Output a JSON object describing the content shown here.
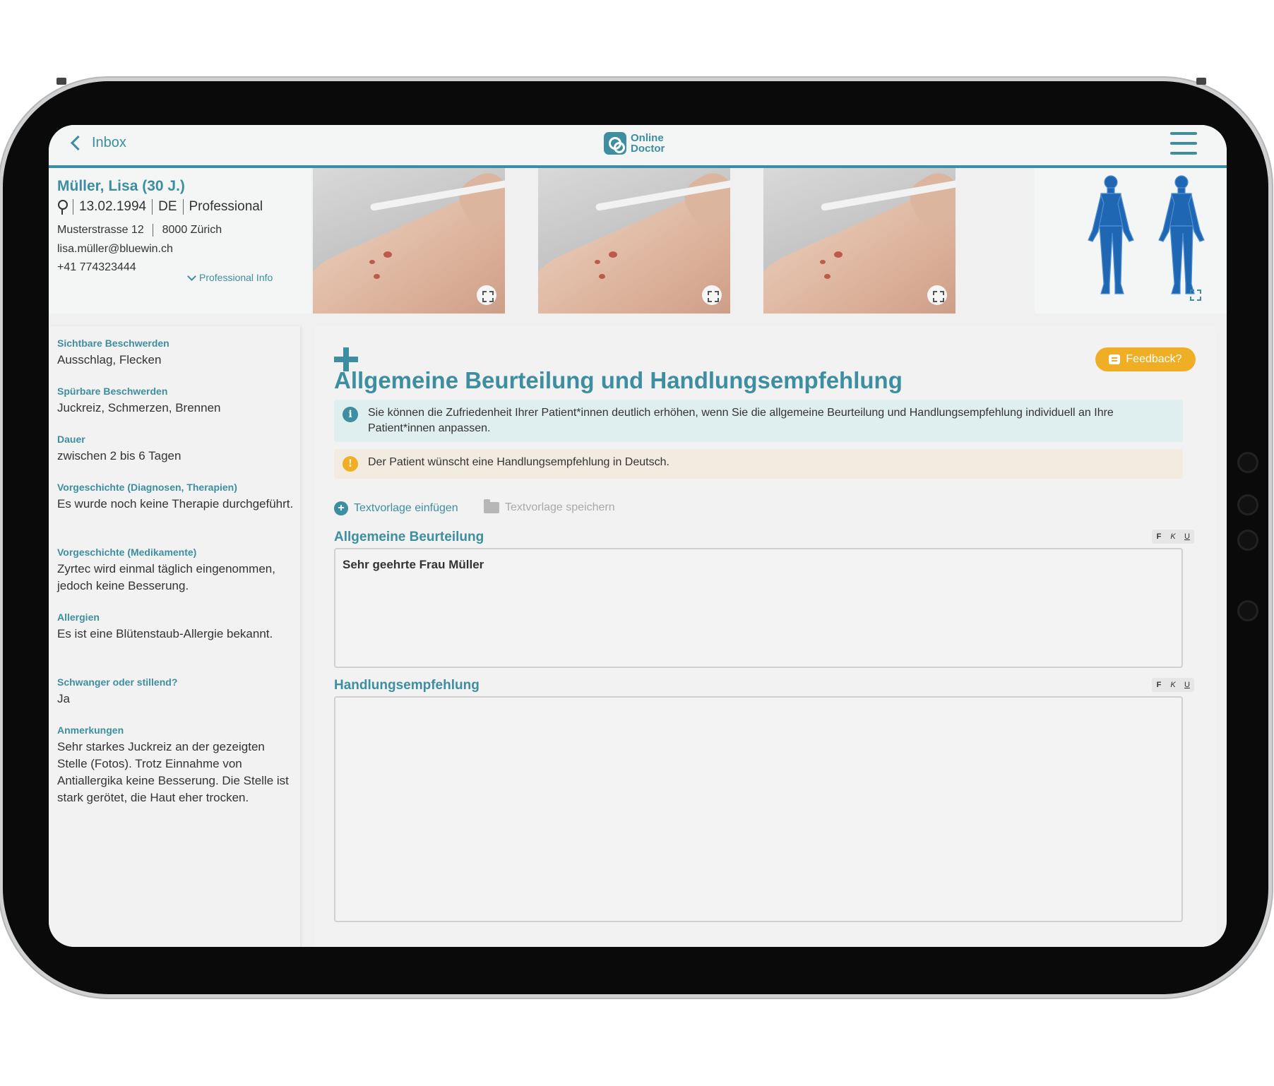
{
  "topbar": {
    "back_label": "Inbox",
    "logo_line1": "Online",
    "logo_line2": "Doctor"
  },
  "patient": {
    "name": "Müller, Lisa (30 J.)",
    "birthdate": "13.02.1994",
    "language": "DE",
    "type": "Professional",
    "address": "Musterstrasse 12",
    "city": "8000 Zürich",
    "email": "lisa.müller@bluewin.ch",
    "phone": "+41 774323444",
    "pro_info_link": "Professional Info"
  },
  "sidebar": {
    "items": [
      {
        "label": "Sichtbare Beschwerden",
        "value": "Ausschlag, Flecken"
      },
      {
        "label": "Spürbare Beschwerden",
        "value": "Juckreiz, Schmerzen, Brennen"
      },
      {
        "label": "Dauer",
        "value": "zwischen 2 bis 6 Tagen"
      },
      {
        "label": "Vorgeschichte (Diagnosen, Therapien)",
        "value": "Es wurde noch keine Therapie durchgeführt."
      },
      {
        "label": "Vorgeschichte (Medikamente)",
        "value": "Zyrtec wird einmal täglich eingenommen, jedoch keine Besserung."
      },
      {
        "label": "Allergien",
        "value": "Es ist eine Blütenstaub-Allergie bekannt."
      },
      {
        "label": "Schwanger oder stillend?",
        "value": "Ja"
      },
      {
        "label": "Anmerkungen",
        "value": "Sehr starkes Juckreiz an der gezeigten Stelle (Fotos). Trotz Einnahme von Antiallergika keine Besserung. Die Stelle ist stark gerötet, die Haut eher trocken."
      }
    ]
  },
  "main": {
    "title": "Allgemeine Beurteilung und Handlungsempfehlung",
    "feedback_label": "Feedback?",
    "info_text": "Sie können die Zufriedenheit Ihrer Patient*innen deutlich erhöhen, wenn Sie die allgemeine Beurteilung und Handlungsempfehlung individuell an Ihre Patient*innen anpassen.",
    "warning_text": "Der Patient wünscht eine Handlungsempfehlung in Deutsch.",
    "insert_template": "Textvorlage einfügen",
    "save_template": "Textvorlage speichern",
    "assessment_title": "Allgemeine Beurteilung",
    "assessment_value": "Sehr geehrte Frau Müller",
    "recommendation_title": "Handlungsempfehlung",
    "recommendation_value": "",
    "format_buttons": [
      "F",
      "K",
      "U"
    ]
  },
  "colors": {
    "accent": "#3d8ea1",
    "feedback": "#f0ae24",
    "info_bg": "#dfeeee",
    "warn_bg": "#f1ebe0",
    "body_map": "#1f66b3"
  },
  "icons": [
    "chevron-left-icon",
    "hamburger-menu-icon",
    "female-icon",
    "chevron-down-icon",
    "expand-icon",
    "plus-icon",
    "info-icon",
    "warning-icon",
    "folder-icon",
    "chat-icon"
  ]
}
